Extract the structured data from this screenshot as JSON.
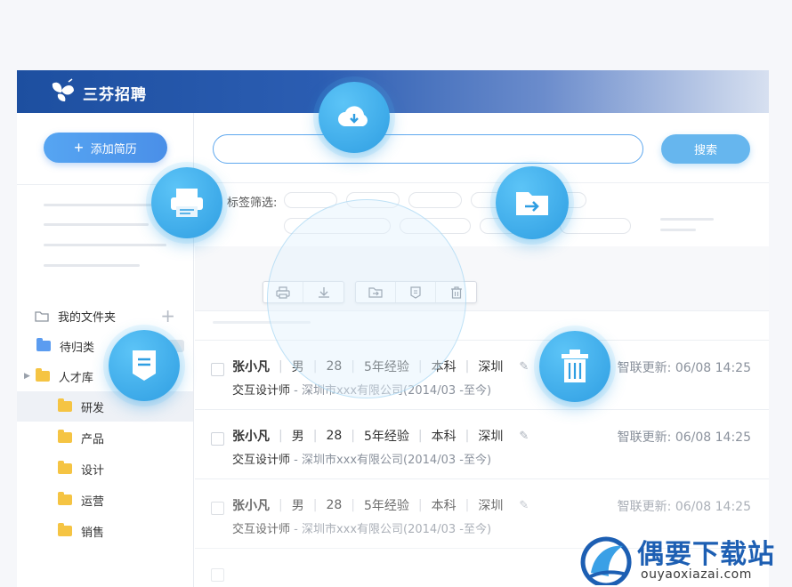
{
  "brand": {
    "name": "三芬招聘"
  },
  "sidebar": {
    "add_resume_label": "添加简历",
    "folders_title": "我的文件夹",
    "items": [
      {
        "label": "待归类",
        "color": "#5b9cf0"
      },
      {
        "label": "人才库",
        "color": "#f5c443"
      },
      {
        "label": "研发",
        "color": "#f5c443"
      },
      {
        "label": "产品",
        "color": "#f5c443"
      },
      {
        "label": "设计",
        "color": "#f5c443"
      },
      {
        "label": "运营",
        "color": "#f5c443"
      },
      {
        "label": "销售",
        "color": "#f5c443"
      }
    ]
  },
  "search": {
    "button_label": "搜索",
    "placeholder": ""
  },
  "filter": {
    "label": "标签筛选:"
  },
  "resumes": [
    {
      "name": "张小凡",
      "gender": "男",
      "age": "28",
      "experience": "5年经验",
      "education": "本科",
      "city": "深圳",
      "position": "交互设计师",
      "company": " - 深圳市xxx有限公司(2014/03 -至今)",
      "update_label": "智联更新:",
      "update_time": "06/08 14:25"
    },
    {
      "name": "张小凡",
      "gender": "男",
      "age": "28",
      "experience": "5年经验",
      "education": "本科",
      "city": "深圳",
      "position": "交互设计师",
      "company": " - 深圳市xxx有限公司(2014/03 -至今)",
      "update_label": "智联更新:",
      "update_time": "06/08 14:25"
    },
    {
      "name": "张小凡",
      "gender": "男",
      "age": "28",
      "experience": "5年经验",
      "education": "本科",
      "city": "深圳",
      "position": "交互设计师",
      "company": " - 深圳市xxx有限公司(2014/03 -至今)",
      "update_label": "智联更新:",
      "update_time": "06/08 14:25"
    }
  ],
  "watermark": {
    "title": "偶要下载站",
    "url": "ouyaoxiazai.com"
  },
  "colors": {
    "accent": "#2f9ee2",
    "brand": "#1d4fa0",
    "folder": "#f5c443"
  }
}
